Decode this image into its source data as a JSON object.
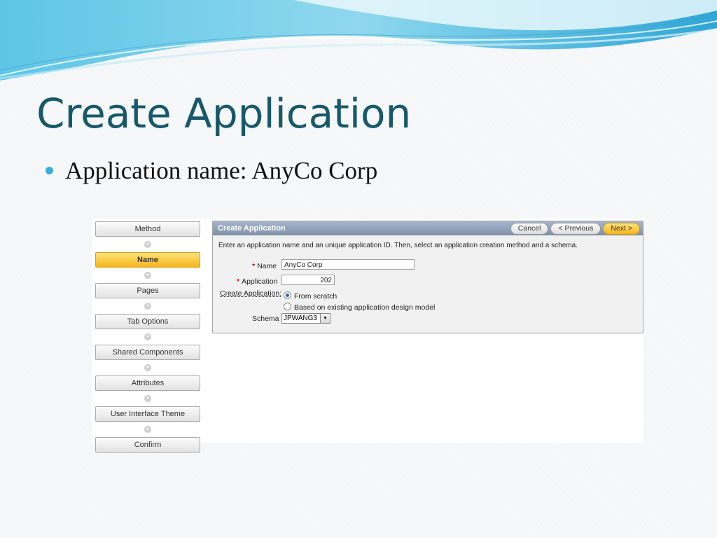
{
  "slide": {
    "title": "Create Application",
    "bullet": "Application name: AnyCo Corp"
  },
  "wizard": {
    "steps": [
      {
        "label": "Method",
        "active": false
      },
      {
        "label": "Name",
        "active": true
      },
      {
        "label": "Pages",
        "active": false
      },
      {
        "label": "Tab Options",
        "active": false
      },
      {
        "label": "Shared Components",
        "active": false
      },
      {
        "label": "Attributes",
        "active": false
      },
      {
        "label": "User Interface Theme",
        "active": false
      },
      {
        "label": "Confirm",
        "active": false
      }
    ]
  },
  "panel": {
    "title": "Create Application",
    "cancel_label": "Cancel",
    "previous_label": "< Previous",
    "next_label": "Next >",
    "instructions": "Enter an application name and an unique application ID. Then, select an application creation method and a schema.",
    "name_label": "Name",
    "name_value": "AnyCo Corp",
    "application_label": "Application",
    "application_value": "202",
    "create_label": "Create Application:",
    "option_scratch": "From scratch",
    "option_existing": "Based on existing application design model",
    "schema_label": "Schema",
    "schema_value": "JPWANG3",
    "required_marker": "*"
  },
  "colors": {
    "title": "#17596a",
    "active_step": "#f5b51c",
    "panel_header": "#7e8fa8",
    "required": "#c1181f"
  }
}
